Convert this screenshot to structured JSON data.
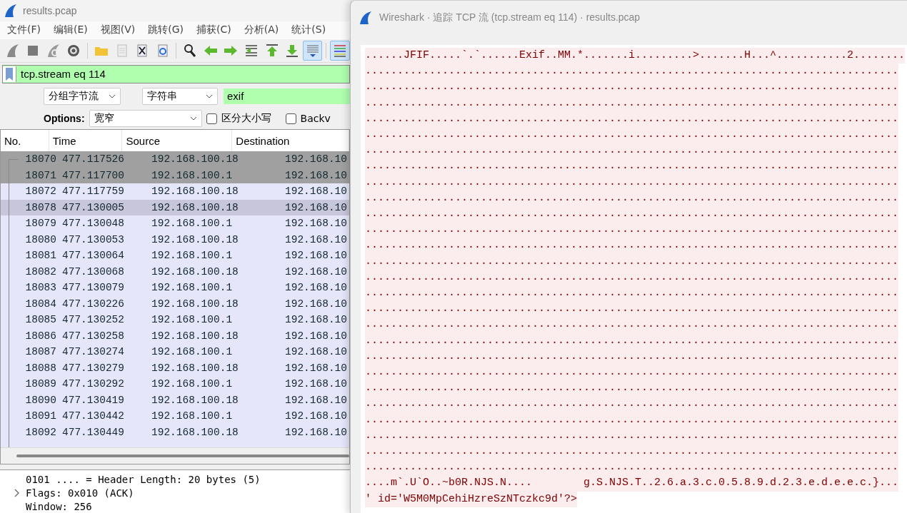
{
  "main_window": {
    "title": "results.pcap",
    "menu": [
      "文件(F)",
      "编辑(E)",
      "视图(V)",
      "跳转(G)",
      "捕获(C)",
      "分析(A)",
      "统计(S)"
    ],
    "toolbar_groups": [
      [
        {
          "pressed": false
        },
        {
          "pressed": false
        },
        {
          "pressed": false
        },
        {
          "pressed": false
        }
      ],
      [
        {
          "pressed": false
        },
        {
          "pressed": false
        },
        {
          "pressed": false
        },
        {
          "pressed": false
        }
      ],
      [
        {
          "pressed": false
        },
        {
          "pressed": false
        },
        {
          "pressed": false
        },
        {
          "pressed": false
        },
        {
          "pressed": false
        },
        {
          "pressed": false
        },
        {
          "pressed": true
        }
      ],
      [
        {
          "pressed": true
        }
      ]
    ],
    "display_filter": {
      "value": "tcp.stream eq 114"
    },
    "find_bar": {
      "search_in": "分组字节流",
      "search_type": "字符串",
      "query": "exif",
      "options_label": "Options:",
      "encoding": "宽窄",
      "case_sensitive": {
        "label": "区分大小写",
        "checked": false
      },
      "backwards": {
        "label": "Backv",
        "checked": false
      }
    },
    "packet_list": {
      "columns": [
        "No.",
        "Time",
        "Source",
        "Destination"
      ],
      "rows": [
        {
          "no": "18070",
          "time": "477.117526",
          "source": "192.168.100.18",
          "destination": "192.168.10",
          "selected": true,
          "highlighted": false
        },
        {
          "no": "18071",
          "time": "477.117700",
          "source": "192.168.100.1",
          "destination": "192.168.10",
          "selected": true,
          "highlighted": false
        },
        {
          "no": "18072",
          "time": "477.117759",
          "source": "192.168.100.18",
          "destination": "192.168.10",
          "selected": false,
          "highlighted": false
        },
        {
          "no": "18078",
          "time": "477.130005",
          "source": "192.168.100.18",
          "destination": "192.168.10",
          "selected": false,
          "highlighted": true
        },
        {
          "no": "18079",
          "time": "477.130048",
          "source": "192.168.100.1",
          "destination": "192.168.10",
          "selected": false,
          "highlighted": false
        },
        {
          "no": "18080",
          "time": "477.130053",
          "source": "192.168.100.18",
          "destination": "192.168.10",
          "selected": false,
          "highlighted": false
        },
        {
          "no": "18081",
          "time": "477.130064",
          "source": "192.168.100.1",
          "destination": "192.168.10",
          "selected": false,
          "highlighted": false
        },
        {
          "no": "18082",
          "time": "477.130068",
          "source": "192.168.100.18",
          "destination": "192.168.10",
          "selected": false,
          "highlighted": false
        },
        {
          "no": "18083",
          "time": "477.130079",
          "source": "192.168.100.1",
          "destination": "192.168.10",
          "selected": false,
          "highlighted": false
        },
        {
          "no": "18084",
          "time": "477.130226",
          "source": "192.168.100.18",
          "destination": "192.168.10",
          "selected": false,
          "highlighted": false
        },
        {
          "no": "18085",
          "time": "477.130252",
          "source": "192.168.100.1",
          "destination": "192.168.10",
          "selected": false,
          "highlighted": false
        },
        {
          "no": "18086",
          "time": "477.130258",
          "source": "192.168.100.18",
          "destination": "192.168.10",
          "selected": false,
          "highlighted": false
        },
        {
          "no": "18087",
          "time": "477.130274",
          "source": "192.168.100.1",
          "destination": "192.168.10",
          "selected": false,
          "highlighted": false
        },
        {
          "no": "18088",
          "time": "477.130279",
          "source": "192.168.100.18",
          "destination": "192.168.10",
          "selected": false,
          "highlighted": false
        },
        {
          "no": "18089",
          "time": "477.130292",
          "source": "192.168.100.1",
          "destination": "192.168.10",
          "selected": false,
          "highlighted": false
        },
        {
          "no": "18090",
          "time": "477.130419",
          "source": "192.168.100.18",
          "destination": "192.168.10",
          "selected": false,
          "highlighted": false
        },
        {
          "no": "18091",
          "time": "477.130442",
          "source": "192.168.100.1",
          "destination": "192.168.10",
          "selected": false,
          "highlighted": false
        },
        {
          "no": "18092",
          "time": "477.130449",
          "source": "192.168.100.18",
          "destination": "192.168.10",
          "selected": false,
          "highlighted": false
        }
      ]
    },
    "packet_details": [
      {
        "text": "0101 .... = Header Length: 20 bytes (5)",
        "expandable": false
      },
      {
        "text": "Flags: 0x010 (ACK)",
        "expandable": true
      },
      {
        "text": "Window: 256",
        "expandable": false
      }
    ]
  },
  "stream_dialog": {
    "title": "Wireshark · 追踪 TCP 流 (tcp.stream eq 114) · results.pcap",
    "lines": [
      "......JFIF.....`.`......Exif..MM.*.......i.........>.......H...^...........2........",
      "...................................................................................",
      "...................................................................................",
      "...................................................................................",
      "...................................................................................",
      "...................................................................................",
      "...................................................................................",
      "...................................................................................",
      "...................................................................................",
      "...................................................................................",
      "...................................................................................",
      "...................................................................................",
      "...................................................................................",
      "...................................................................................",
      "...................................................................................",
      "...................................................................................",
      "...................................................................................",
      "...................................................................................",
      "...................................................................................",
      "...................................................................................",
      "...................................................................................",
      "...................................................................................",
      "...................................................................................",
      "...................................................................................",
      "...................................................................................",
      "...................................................................................",
      "...................................................................................",
      "....m`.U`O..~b0R.NJS.N....        g.S.NJS.T..2.6.a.3.c.0.5.8.9.d.2.3.e.d.e.e.c.}...",
      "' id='W5M0MpCehiHzreSzNTczkc9d'?>"
    ]
  }
}
